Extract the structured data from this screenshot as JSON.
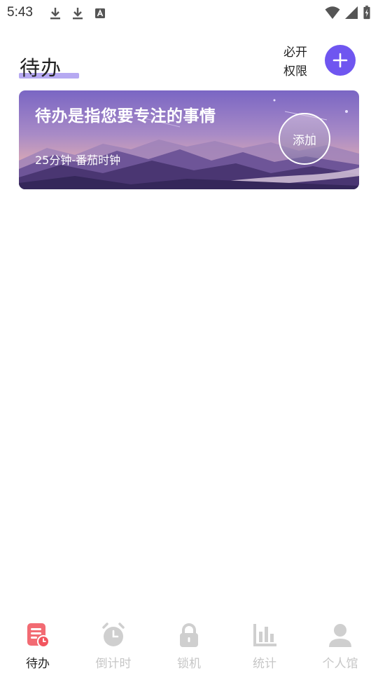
{
  "status_bar": {
    "time": "5:43",
    "left_icons": [
      "download-icon",
      "download-icon",
      "text-a-icon"
    ],
    "right_icons": [
      "wifi-icon",
      "cell-signal-icon",
      "battery-charging-icon"
    ]
  },
  "header": {
    "title": "待办",
    "permission_line1": "必开",
    "permission_line2": "权限",
    "add_icon": "plus-icon",
    "accent_color": "#6f56f0",
    "underline_color": "#b6a9f2"
  },
  "banner": {
    "title": "待办是指您要专注的事情",
    "subtitle": "25分钟-番茄时钟",
    "add_label": "添加"
  },
  "bottom_nav": {
    "items": [
      {
        "label": "待办",
        "icon": "todo-list-icon",
        "active": true
      },
      {
        "label": "倒计时",
        "icon": "alarm-clock-icon",
        "active": false
      },
      {
        "label": "锁机",
        "icon": "lock-icon",
        "active": false
      },
      {
        "label": "统计",
        "icon": "bar-chart-icon",
        "active": false
      },
      {
        "label": "个人馆",
        "icon": "person-icon",
        "active": false
      }
    ]
  }
}
